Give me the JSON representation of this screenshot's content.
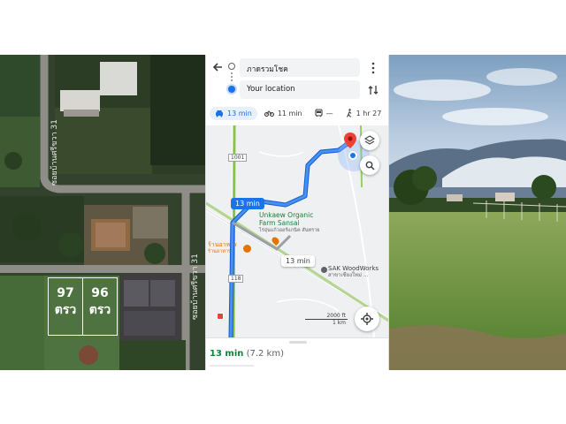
{
  "satellite": {
    "road_labels": [
      "ซอยบ้านศรีขวา 31",
      "ซอยบ้านศรีขวา 31"
    ],
    "plots": [
      {
        "number": "97",
        "unit": "ตรว"
      },
      {
        "number": "96",
        "unit": "ตรว"
      }
    ]
  },
  "maps_app": {
    "destination": "ภาดรวมโชค",
    "origin": "Your location",
    "modes": [
      {
        "icon": "car-icon",
        "label": "13 min",
        "active": true
      },
      {
        "icon": "motorbike-icon",
        "label": "11 min",
        "active": false
      },
      {
        "icon": "transit-icon",
        "label": "—",
        "active": false
      },
      {
        "icon": "walk-icon",
        "label": "1 hr 27",
        "active": false
      }
    ],
    "route_eta": "13 min",
    "alt_route_eta": "13 min",
    "pois": {
      "organic_farm": "Unkaew Organic\nFarm Sansai",
      "organic_farm_thai": "ไร่อุ่นแก้วออร์แกนิค สันทราย",
      "sak": "SAK WoodWorks",
      "sak_thai": "สาขาเชียงใหม่ ...",
      "restaurant": "ร้านอาหาร",
      "restaurant_sub": "ร้านอาหาร"
    },
    "road_numbers": [
      "118",
      "1001"
    ],
    "scale": {
      "ft": "2000 ft",
      "km": "1 km"
    },
    "summary_time": "13 min",
    "summary_distance": "(7.2 km)",
    "colors": {
      "route": "#1a73e8",
      "accent": "#1a73e8",
      "pin": "#ea4335"
    }
  },
  "photo": {
    "scene": "landscape"
  }
}
